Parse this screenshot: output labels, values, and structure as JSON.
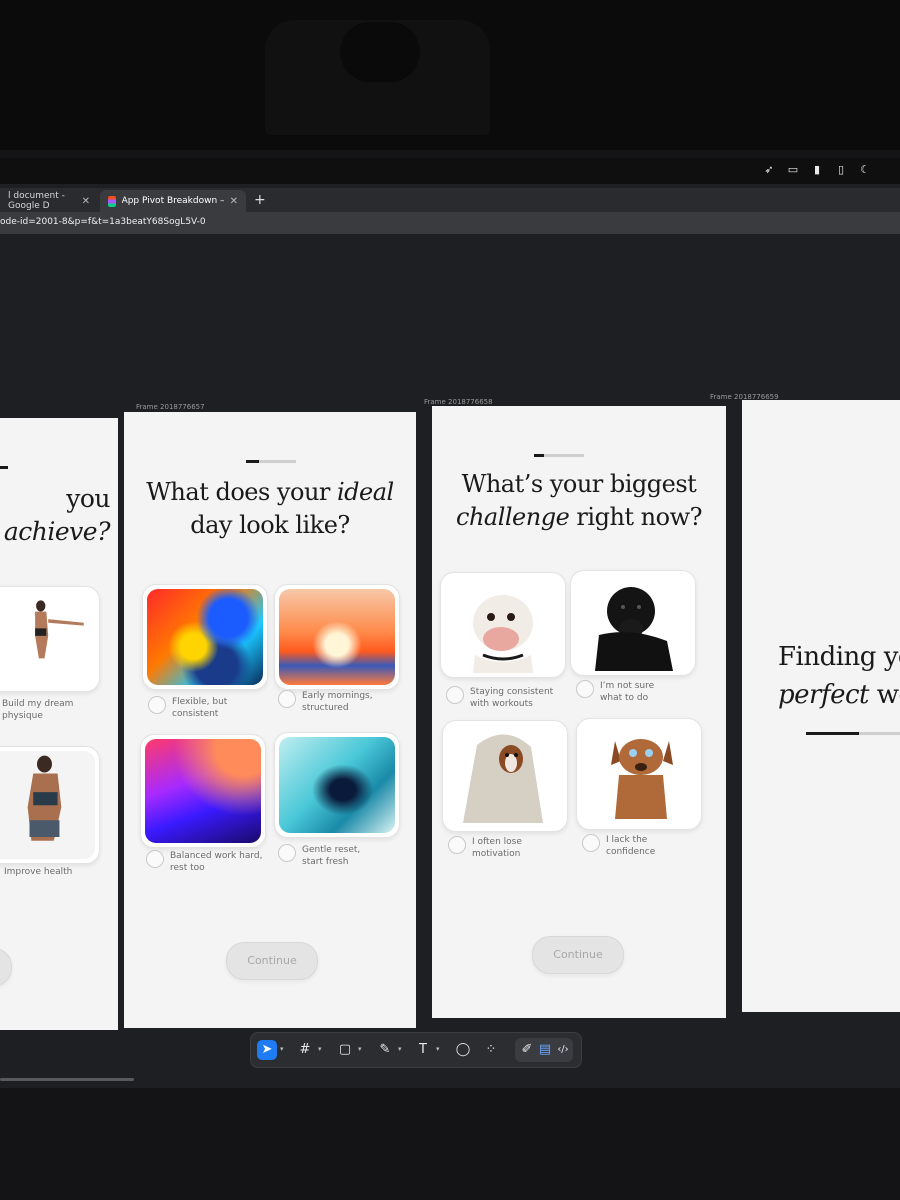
{
  "browser": {
    "tabs": [
      {
        "label": "l document - Google D"
      },
      {
        "label": "App Pivot Breakdown – Figma"
      }
    ],
    "new_tab_label": "+",
    "url": "ode-id=2001-8&p=f&t=1a3beatY68SogL5V-0"
  },
  "tray": [
    "rocket-icon",
    "keyboard-icon",
    "battery-icon",
    "document-icon",
    "moon-icon"
  ],
  "frames": {
    "left_partial": {
      "title_line1": "you",
      "title_line2": "achieve?",
      "options": [
        {
          "label": "Build my dream physique"
        },
        {
          "label": "Improve health"
        }
      ]
    },
    "f1": {
      "name": "Frame 2018776657",
      "title_pre": "What does your ",
      "title_em": "ideal",
      "title_post": "day look like?",
      "progress_fraction": 0.25,
      "options": [
        {
          "label": "Flexible, but consistent"
        },
        {
          "label": "Early mornings, structured"
        },
        {
          "label": "Balanced work hard, rest too"
        },
        {
          "label": "Gentle reset, start fresh"
        }
      ],
      "continue_label": "Continue"
    },
    "f2": {
      "name": "Frame 2018776658",
      "title_line1": "What’s your biggest",
      "title_em": "challenge",
      "title_post": " right now?",
      "progress_fraction": 0.2,
      "options": [
        {
          "label": "Staying consistent with workouts"
        },
        {
          "label": "I’m not sure what to do"
        },
        {
          "label": "I often lose motivation"
        },
        {
          "label": "I lack the confidence"
        }
      ],
      "continue_label": "Continue"
    },
    "f3": {
      "name": "Frame 2018776659",
      "title_line1": "Finding yo",
      "title_em": "perfect",
      "title_post": " wor",
      "progress_fraction": 0.5
    }
  },
  "toolbar": {
    "tools": [
      "move-tool-icon",
      "frame-tool-icon",
      "rectangle-tool-icon",
      "pen-tool-icon",
      "text-tool-icon",
      "comment-tool-icon",
      "actions-tool-icon"
    ],
    "text_tool_glyph": "T",
    "mode_tools": [
      "draw-mode-icon",
      "design-mode-icon",
      "dev-mode-icon"
    ]
  }
}
